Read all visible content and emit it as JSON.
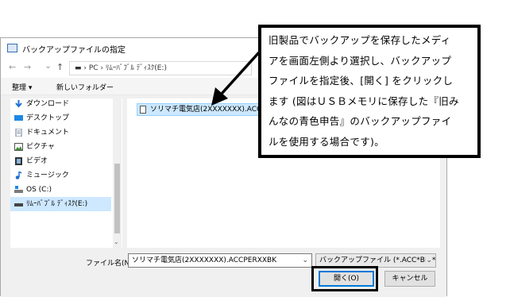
{
  "dialog": {
    "title": "バックアップファイルの指定",
    "nav_back": "←",
    "nav_forward": "→",
    "nav_dropdown": "⌄",
    "nav_up": "↑",
    "address": "▬  ›  PC  ›  ﾘﾑｰﾊﾞﾌﾞﾙ ﾃﾞｨｽｸ(E:)",
    "toolbar": {
      "organize": "整理 ▾",
      "new_folder": "新しいフォルダー"
    },
    "sidebar": {
      "items": [
        {
          "label": "ダウンロード",
          "icon": "download-icon"
        },
        {
          "label": "デスクトップ",
          "icon": "desktop-icon"
        },
        {
          "label": "ドキュメント",
          "icon": "document-icon"
        },
        {
          "label": "ピクチャ",
          "icon": "picture-icon"
        },
        {
          "label": "ビデオ",
          "icon": "video-icon"
        },
        {
          "label": "ミュージック",
          "icon": "music-icon"
        },
        {
          "label": "OS (C:)",
          "icon": "drive-icon"
        },
        {
          "label": "ﾘﾑｰﾊﾞﾌﾞﾙ ﾃﾞｨｽｸ(E:)",
          "icon": "usb-drive-icon"
        }
      ]
    },
    "scroll_down": "⌄",
    "file": {
      "name": "ソリマチ電気店(2XXXXXXX).ACCPERXXBK"
    },
    "filename_label": "ファイル名(N):",
    "filename_value": "ソリマチ電気店(2XXXXXXX).ACCPERXXBK",
    "filter_value": "バックアップファイル (*.ACC*BK;*.AC",
    "open_button": "開く(O)",
    "cancel_button": "キャンセル",
    "chevron": "⌄"
  },
  "callout": {
    "lines": [
      "旧製品でバックアップを保存したメディ",
      "アを画面左側より選択し、バックアップ",
      "ファイルを指定後、[開く] をクリックし",
      "ます (図はＵＳＢメモリに保存した『旧み",
      "んなの青色申告』のバックアップファイ",
      "ルを使用する場合です)。"
    ]
  },
  "colors": {
    "selection": "#cce8ff",
    "accent": "#0078d7",
    "annotation": "#000000"
  }
}
